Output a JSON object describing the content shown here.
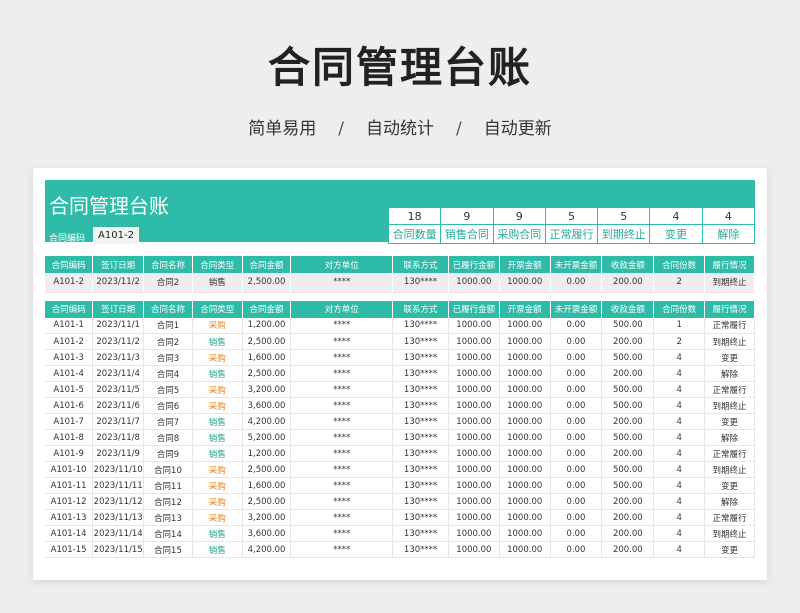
{
  "header": {
    "title": "合同管理台账",
    "subtitle_items": [
      "简单易用",
      "自动统计",
      "自动更新"
    ],
    "separator": "/"
  },
  "sheet": {
    "banner_title": "合同管理台账",
    "code_label": "合同编码",
    "code_value": "A101-2",
    "stats": [
      {
        "value": "18",
        "label": "合同数量"
      },
      {
        "value": "9",
        "label": "销售合同"
      },
      {
        "value": "9",
        "label": "采购合同"
      },
      {
        "value": "5",
        "label": "正常履行"
      },
      {
        "value": "5",
        "label": "到期终止"
      },
      {
        "value": "4",
        "label": "变更"
      },
      {
        "value": "4",
        "label": "解除"
      }
    ],
    "columns": [
      "合同编码",
      "签订日期",
      "合同名称",
      "合同类型",
      "合同金额",
      "对方单位",
      "联系方式",
      "已履行金额",
      "开票金额",
      "未开票金额",
      "收款金额",
      "合同份数",
      "履行情况"
    ],
    "search_result": [
      "A101-2",
      "2023/11/2",
      "合同2",
      "销售",
      "2,500.00",
      "****",
      "130****",
      "1000.00",
      "1000.00",
      "0.00",
      "200.00",
      "2",
      "到期终止"
    ],
    "rows": [
      [
        "A101-1",
        "2023/11/1",
        "合同1",
        "采购",
        "1,200.00",
        "****",
        "130****",
        "1000.00",
        "1000.00",
        "0.00",
        "500.00",
        "1",
        "正常履行"
      ],
      [
        "A101-2",
        "2023/11/2",
        "合同2",
        "销售",
        "2,500.00",
        "****",
        "130****",
        "1000.00",
        "1000.00",
        "0.00",
        "200.00",
        "2",
        "到期终止"
      ],
      [
        "A101-3",
        "2023/11/3",
        "合同3",
        "采购",
        "1,600.00",
        "****",
        "130****",
        "1000.00",
        "1000.00",
        "0.00",
        "500.00",
        "4",
        "变更"
      ],
      [
        "A101-4",
        "2023/11/4",
        "合同4",
        "销售",
        "2,500.00",
        "****",
        "130****",
        "1000.00",
        "1000.00",
        "0.00",
        "200.00",
        "4",
        "解除"
      ],
      [
        "A101-5",
        "2023/11/5",
        "合同5",
        "采购",
        "3,200.00",
        "****",
        "130****",
        "1000.00",
        "1000.00",
        "0.00",
        "500.00",
        "4",
        "正常履行"
      ],
      [
        "A101-6",
        "2023/11/6",
        "合同6",
        "采购",
        "3,600.00",
        "****",
        "130****",
        "1000.00",
        "1000.00",
        "0.00",
        "500.00",
        "4",
        "到期终止"
      ],
      [
        "A101-7",
        "2023/11/7",
        "合同7",
        "销售",
        "4,200.00",
        "****",
        "130****",
        "1000.00",
        "1000.00",
        "0.00",
        "200.00",
        "4",
        "变更"
      ],
      [
        "A101-8",
        "2023/11/8",
        "合同8",
        "销售",
        "5,200.00",
        "****",
        "130****",
        "1000.00",
        "1000.00",
        "0.00",
        "500.00",
        "4",
        "解除"
      ],
      [
        "A101-9",
        "2023/11/9",
        "合同9",
        "销售",
        "1,200.00",
        "****",
        "130****",
        "1000.00",
        "1000.00",
        "0.00",
        "200.00",
        "4",
        "正常履行"
      ],
      [
        "A101-10",
        "2023/11/10",
        "合同10",
        "采购",
        "2,500.00",
        "****",
        "130****",
        "1000.00",
        "1000.00",
        "0.00",
        "500.00",
        "4",
        "到期终止"
      ],
      [
        "A101-11",
        "2023/11/11",
        "合同11",
        "采购",
        "1,600.00",
        "****",
        "130****",
        "1000.00",
        "1000.00",
        "0.00",
        "500.00",
        "4",
        "变更"
      ],
      [
        "A101-12",
        "2023/11/12",
        "合同12",
        "采购",
        "2,500.00",
        "****",
        "130****",
        "1000.00",
        "1000.00",
        "0.00",
        "200.00",
        "4",
        "解除"
      ],
      [
        "A101-13",
        "2023/11/13",
        "合同13",
        "采购",
        "3,200.00",
        "****",
        "130****",
        "1000.00",
        "1000.00",
        "0.00",
        "200.00",
        "4",
        "正常履行"
      ],
      [
        "A101-14",
        "2023/11/14",
        "合同14",
        "销售",
        "3,600.00",
        "****",
        "130****",
        "1000.00",
        "1000.00",
        "0.00",
        "200.00",
        "4",
        "到期终止"
      ],
      [
        "A101-15",
        "2023/11/15",
        "合同15",
        "销售",
        "4,200.00",
        "****",
        "130****",
        "1000.00",
        "1000.00",
        "0.00",
        "200.00",
        "4",
        "变更"
      ]
    ]
  },
  "colors": {
    "accent": "#2ebba7",
    "sales_type": "#1ea08c",
    "purchase_type": "#e6862a"
  }
}
